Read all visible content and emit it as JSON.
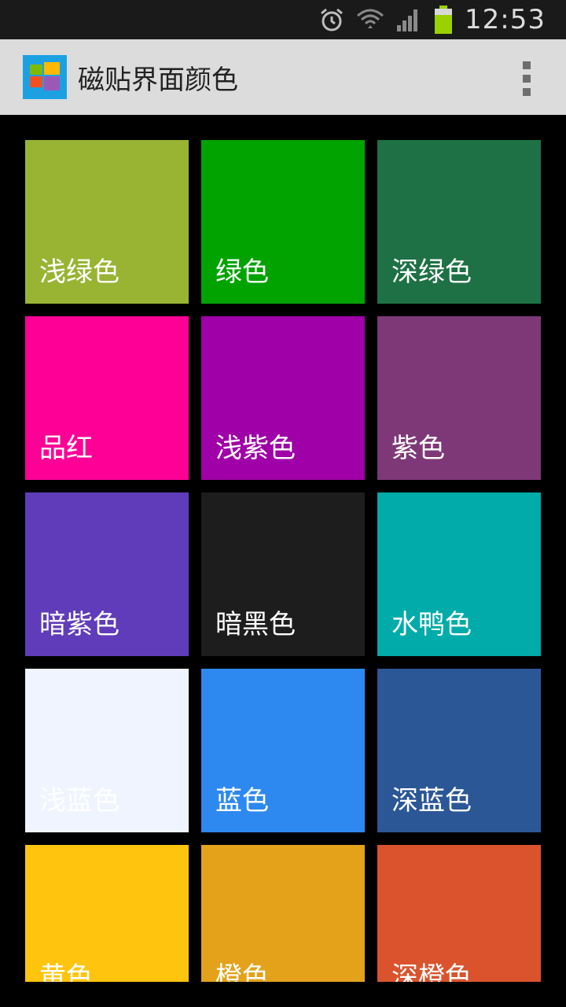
{
  "status_bar": {
    "time": "12:53",
    "icons": [
      "alarm-icon",
      "wifi-icon",
      "signal-icon",
      "battery-icon"
    ]
  },
  "action_bar": {
    "title": "磁贴界面颜色",
    "app_icon": "windows-tiles-icon",
    "menu_icon": "overflow-menu-icon"
  },
  "tiles": [
    {
      "label": "浅绿色",
      "color": "#99b433",
      "text_color": "#ffffff"
    },
    {
      "label": "绿色",
      "color": "#00a300",
      "text_color": "#ffffff"
    },
    {
      "label": "深绿色",
      "color": "#1e7145",
      "text_color": "#ffffff"
    },
    {
      "label": "品红",
      "color": "#ff0097",
      "text_color": "#ffffff"
    },
    {
      "label": "浅紫色",
      "color": "#9f00a7",
      "text_color": "#ffffff"
    },
    {
      "label": "紫色",
      "color": "#7e3878",
      "text_color": "#ffffff"
    },
    {
      "label": "暗紫色",
      "color": "#603cba",
      "text_color": "#ffffff"
    },
    {
      "label": "暗黑色",
      "color": "#1d1d1d",
      "text_color": "#ffffff"
    },
    {
      "label": "水鸭色",
      "color": "#00aba9",
      "text_color": "#ffffff"
    },
    {
      "label": "浅蓝色",
      "color": "#eff4ff",
      "text_color": "#ffffff"
    },
    {
      "label": "蓝色",
      "color": "#2d89ef",
      "text_color": "#ffffff"
    },
    {
      "label": "深蓝色",
      "color": "#2b5797",
      "text_color": "#ffffff"
    },
    {
      "label": "黄色",
      "color": "#ffc40d",
      "text_color": "#ffffff"
    },
    {
      "label": "橙色",
      "color": "#e3a21a",
      "text_color": "#ffffff"
    },
    {
      "label": "深橙色",
      "color": "#da532c",
      "text_color": "#ffffff"
    }
  ]
}
